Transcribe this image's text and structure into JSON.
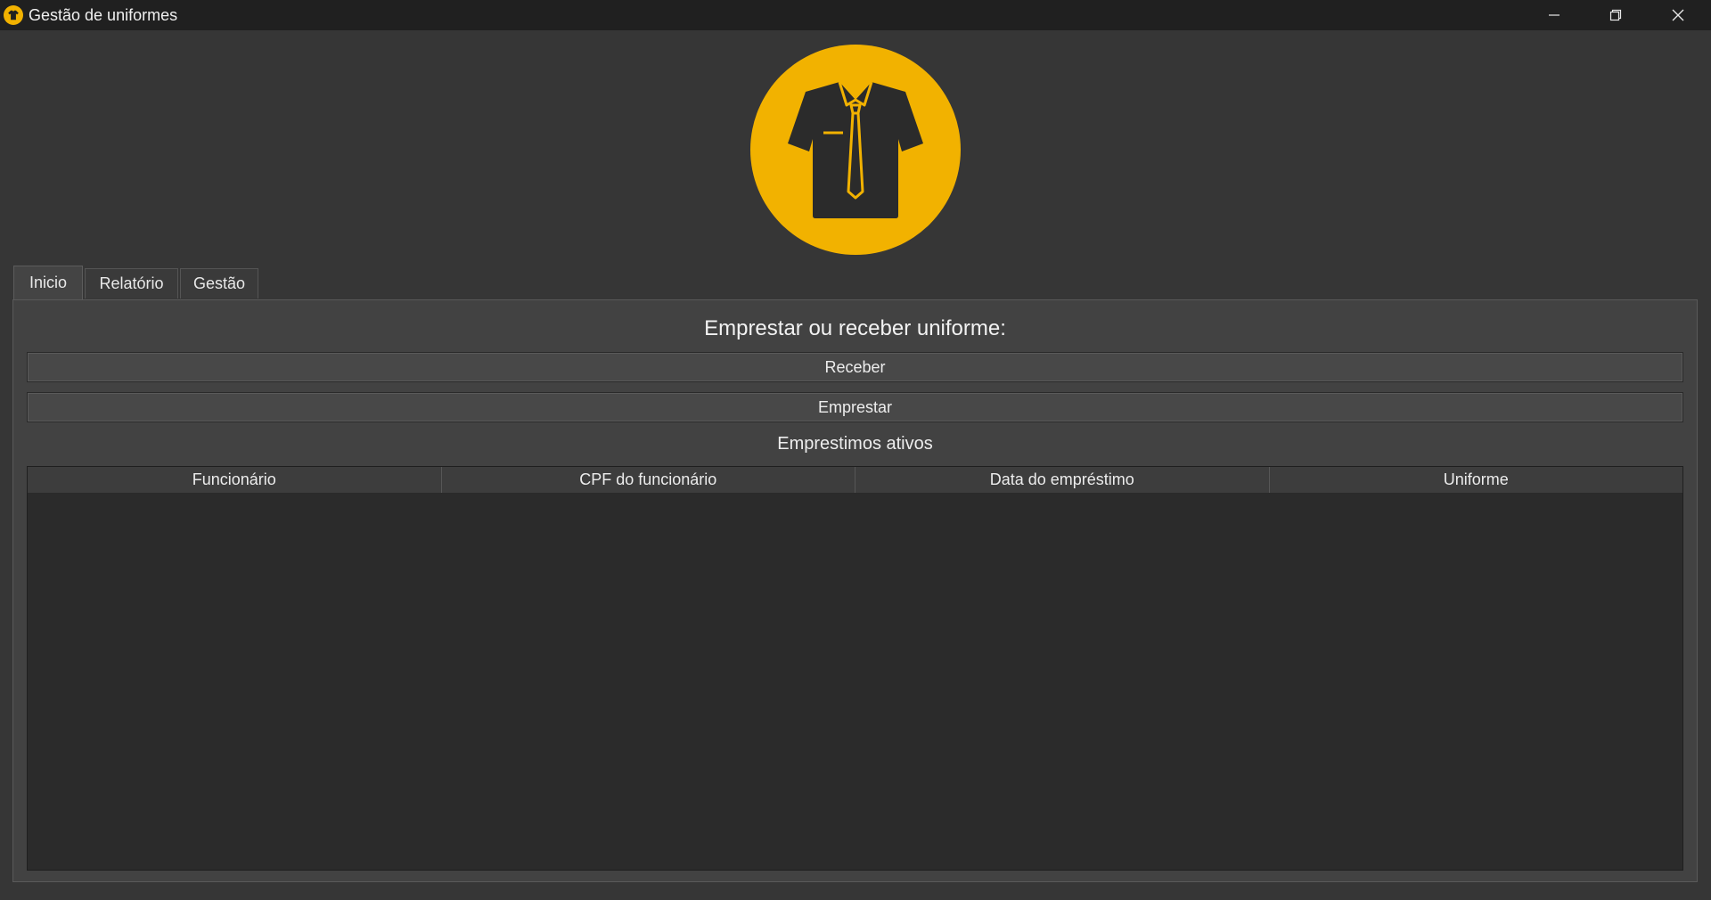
{
  "window": {
    "title": "Gestão de uniformes",
    "icon": "shirt-tie-icon",
    "accent_color": "#f2b200"
  },
  "logo": {
    "icon": "shirt-with-tie-icon",
    "color": "#f2b200"
  },
  "tabs": [
    {
      "label": "Inicio",
      "active": true
    },
    {
      "label": "Relatório",
      "active": false
    },
    {
      "label": "Gestão",
      "active": false
    }
  ],
  "main": {
    "heading": "Emprestar ou receber uniforme:",
    "receive_button": "Receber",
    "lend_button": "Emprestar",
    "active_loans_label": "Emprestimos ativos",
    "table": {
      "columns": [
        "Funcionário",
        "CPF do funcionário",
        "Data do empréstimo",
        "Uniforme"
      ],
      "rows": []
    }
  }
}
